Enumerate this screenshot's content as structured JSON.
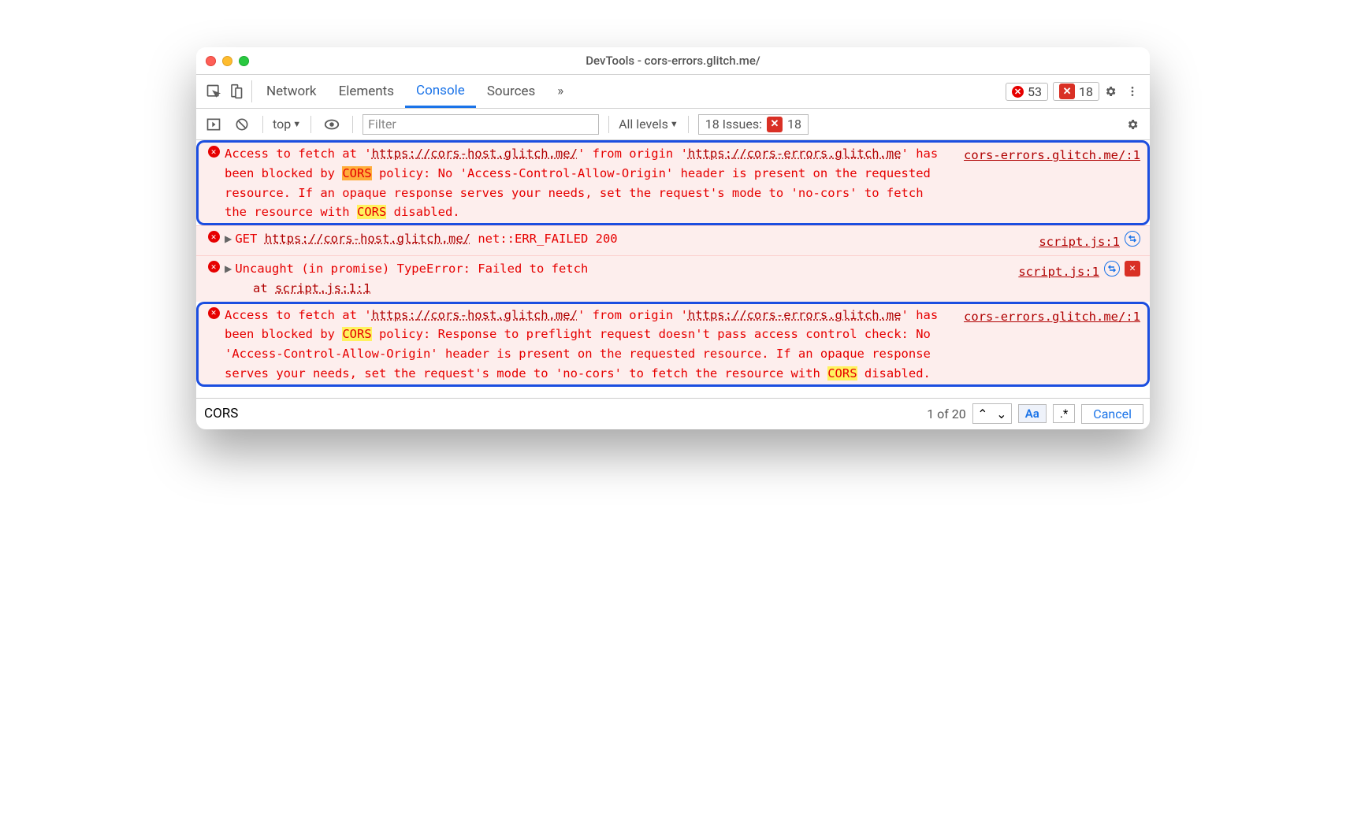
{
  "window": {
    "title": "DevTools - cors-errors.glitch.me/"
  },
  "tabs": {
    "network": "Network",
    "elements": "Elements",
    "console": "Console",
    "sources": "Sources"
  },
  "counters": {
    "errors": "53",
    "issues": "18"
  },
  "console_toolbar": {
    "context": "top",
    "filter_placeholder": "Filter",
    "levels": "All levels",
    "issues_label": "18 Issues:",
    "issues_count": "18"
  },
  "messages": {
    "m1": {
      "pre1": "Access to fetch at '",
      "url1": "https://cors-host.glitch.me/",
      "mid1": "' from origin '",
      "url2": "https://cors-errors.glitch.me",
      "mid2": "' has been blocked by ",
      "cors1": "CORS",
      "mid3": " policy: No 'Access-Control-Allow-Origin' header is present on the requested resource. If an opaque response serves your needs, set the request's mode to 'no-cors' to fetch the resource with ",
      "cors2": "CORS",
      "tail": " disabled.",
      "src": "cors-errors.glitch.me/:1"
    },
    "m2": {
      "verb": "GET",
      "url": "https://cors-host.glitch.me/",
      "status": "net::ERR_FAILED 200",
      "src": "script.js:1"
    },
    "m3": {
      "line1": "Uncaught (in promise) TypeError: Failed to fetch",
      "line2pre": "    at ",
      "line2link": "script.js:1:1",
      "src": "script.js:1"
    },
    "m4": {
      "pre1": "Access to fetch at '",
      "url1": "https://cors-host.glitch.me/",
      "mid1": "' from origin '",
      "url2": "https://cors-errors.glitch.me",
      "mid2": "' has been blocked by ",
      "cors1": "CORS",
      "mid3": " policy: Response to preflight request doesn't pass access control check: No 'Access-Control-Allow-Origin' header is present on the requested resource. If an opaque response serves your needs, set the request's mode to 'no-cors' to fetch the resource with ",
      "cors2": "CORS",
      "tail": " disabled.",
      "src": "cors-errors.glitch.me/:1"
    }
  },
  "search": {
    "query": "CORS",
    "count": "1 of 20",
    "mode_case": "Aa",
    "mode_regex": ".*",
    "cancel": "Cancel"
  },
  "icons": {
    "error_circle": "✕",
    "issue_square": "✕",
    "chevron_up": "⌃",
    "chevron_down": "⌄",
    "triangle_down": "▼",
    "triangle_right": "▶",
    "overflow": "»"
  }
}
